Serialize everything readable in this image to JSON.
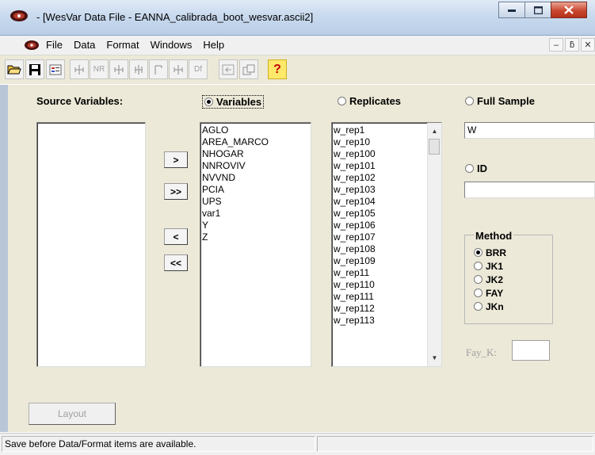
{
  "window": {
    "title": "- [WesVar Data File - EANNA_calibrada_boot_wesvar.ascii2]"
  },
  "menu": {
    "items": [
      "File",
      "Data",
      "Format",
      "Windows",
      "Help"
    ]
  },
  "mdi_controls": [
    "–",
    "ƃ",
    "✕"
  ],
  "toolbar": {
    "nr_label": "NR",
    "df_label": "Df",
    "help_label": "?"
  },
  "labels": {
    "source_variables": "Source Variables:",
    "variables": "Variables",
    "replicates": "Replicates",
    "full_sample": "Full Sample",
    "id": "ID",
    "method": "Method",
    "fay_k": "Fay_K:"
  },
  "source_variables": [],
  "variables": [
    "AGLO",
    "AREA_MARCO",
    "NHOGAR",
    "NNROVIV",
    "NVVND",
    "PCIA",
    "UPS",
    "var1",
    "Y",
    "Z"
  ],
  "replicates": [
    "w_rep1",
    "w_rep10",
    "w_rep100",
    "w_rep101",
    "w_rep102",
    "w_rep103",
    "w_rep104",
    "w_rep105",
    "w_rep106",
    "w_rep107",
    "w_rep108",
    "w_rep109",
    "w_rep11",
    "w_rep110",
    "w_rep111",
    "w_rep112",
    "w_rep113"
  ],
  "buttons": {
    "move_right": ">",
    "move_all_right": ">>",
    "move_left": "<",
    "move_all_left": "<<",
    "layout": "Layout"
  },
  "full_sample_value": "W",
  "id_value": "",
  "fay_k_value": "",
  "methods": [
    "BRR",
    "JK1",
    "JK2",
    "FAY",
    "JKn"
  ],
  "selected_method": "BRR",
  "selected_mode": "Variables",
  "status": {
    "message": "Save before Data/Format items are available.",
    "secondary": ""
  }
}
